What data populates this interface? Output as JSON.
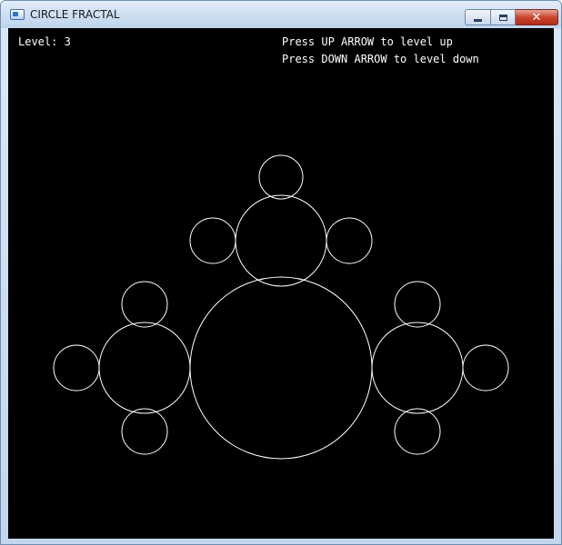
{
  "window": {
    "title": "CIRCLE FRACTAL",
    "icon": "app-window-icon",
    "buttons": {
      "minimize": "minimize-icon",
      "maximize": "maximize-icon",
      "close": "close-icon"
    }
  },
  "hud": {
    "level_label": "Level:",
    "level_value": "3",
    "help_up": "Press UP ARROW to level up",
    "help_down": "Press DOWN ARROW to level down"
  },
  "colors": {
    "canvas_background": "#000000",
    "stroke": "#ffffff",
    "close_button": "#c9452f"
  }
}
